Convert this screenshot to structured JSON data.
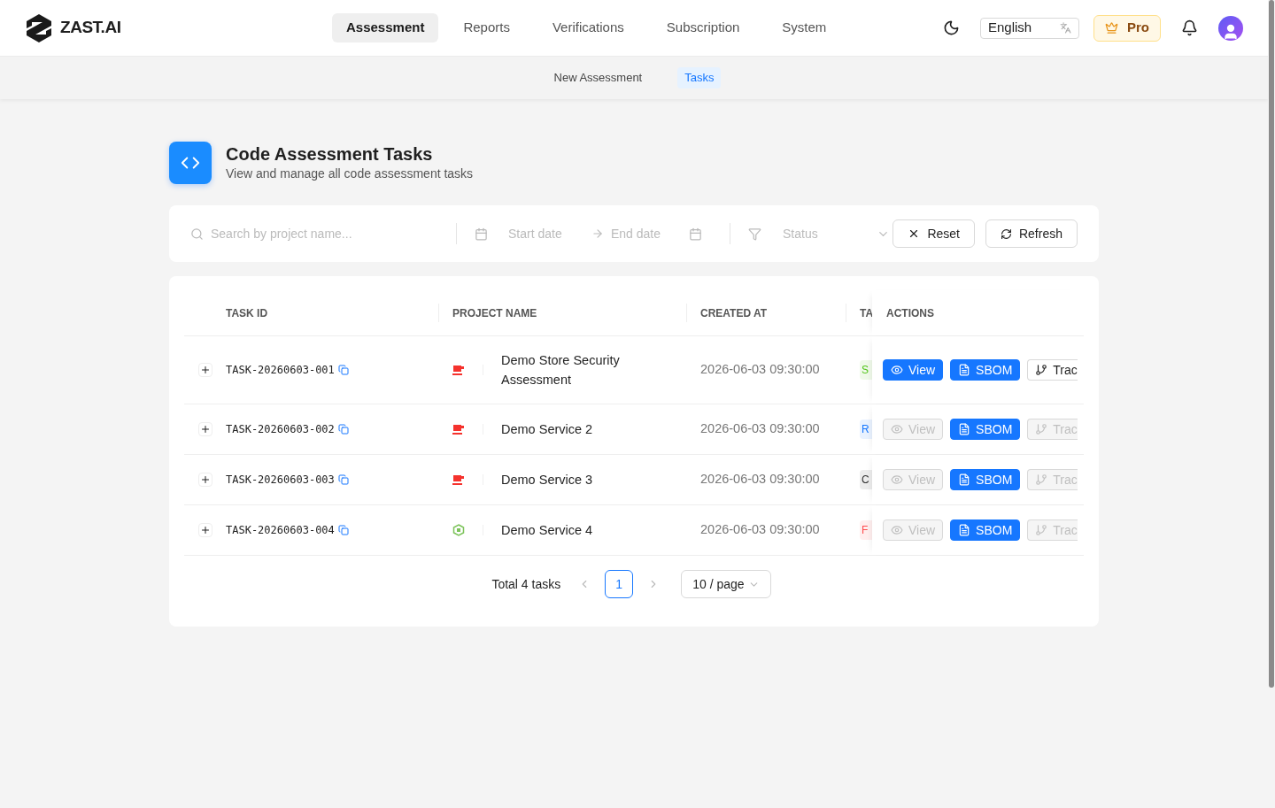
{
  "brand": {
    "name": "ZAST.AI"
  },
  "nav": [
    {
      "label": "Assessment",
      "selected": true
    },
    {
      "label": "Reports",
      "selected": false
    },
    {
      "label": "Verifications",
      "selected": false
    },
    {
      "label": "Subscription",
      "selected": false
    },
    {
      "label": "System",
      "selected": false
    }
  ],
  "language": {
    "value": "English"
  },
  "plan_badge": {
    "label": "Pro"
  },
  "subnav": [
    {
      "label": "New Assessment",
      "selected": false
    },
    {
      "label": "Tasks",
      "selected": true
    }
  ],
  "page": {
    "title": "Code Assessment Tasks",
    "subtitle": "View and manage all code assessment tasks"
  },
  "filters": {
    "search": {
      "placeholder": "Search by project name..."
    },
    "start_date": {
      "placeholder": "Start date"
    },
    "end_date": {
      "placeholder": "End date"
    },
    "status": {
      "placeholder": "Status"
    },
    "buttons": [
      {
        "kind": "reset",
        "label": "Reset"
      },
      {
        "kind": "refresh",
        "label": "Refresh"
      }
    ]
  },
  "table": {
    "columns": [
      "TASK ID",
      "PROJECT NAME",
      "CREATED AT",
      "TA",
      "ACTIONS"
    ],
    "rows": [
      {
        "task_id": "TASK-20260603-001",
        "project_icon": {
          "kind": "cup"
        },
        "project": "Demo Store Security Assessment",
        "created_at": "2026-06-03 09:30:00",
        "status": {
          "label": "S",
          "color": "#52c41a"
        },
        "actions": [
          {
            "kind": "view",
            "label": "View",
            "disabled": false
          },
          {
            "kind": "sbom",
            "label": "SBOM",
            "disabled": false
          },
          {
            "kind": "trace",
            "label": "Trac",
            "disabled": false
          }
        ]
      },
      {
        "task_id": "TASK-20260603-002",
        "project_icon": {
          "kind": "cup"
        },
        "project": "Demo Service 2",
        "created_at": "2026-06-03 09:30:00",
        "status": {
          "label": "R",
          "color": "#1677ff"
        },
        "actions": [
          {
            "kind": "view",
            "label": "View",
            "disabled": true
          },
          {
            "kind": "sbom",
            "label": "SBOM",
            "disabled": false
          },
          {
            "kind": "trace",
            "label": "Trac",
            "disabled": true
          }
        ]
      },
      {
        "task_id": "TASK-20260603-003",
        "project_icon": {
          "kind": "cup"
        },
        "project": "Demo Service 3",
        "created_at": "2026-06-03 09:30:00",
        "status": {
          "label": "C",
          "color": "#333333"
        },
        "actions": [
          {
            "kind": "view",
            "label": "View",
            "disabled": true
          },
          {
            "kind": "sbom",
            "label": "SBOM",
            "disabled": false
          },
          {
            "kind": "trace",
            "label": "Trac",
            "disabled": true
          }
        ]
      },
      {
        "task_id": "TASK-20260603-004",
        "project_icon": {
          "kind": "hexagon"
        },
        "project": "Demo Service 4",
        "created_at": "2026-06-03 09:30:00",
        "status": {
          "label": "F",
          "color": "#ff4d4f"
        },
        "actions": [
          {
            "kind": "view",
            "label": "View",
            "disabled": true
          },
          {
            "kind": "sbom",
            "label": "SBOM",
            "disabled": false
          },
          {
            "kind": "trace",
            "label": "Trac",
            "disabled": true
          }
        ]
      }
    ]
  },
  "pagination": {
    "total": "Total 4 tasks",
    "pages": [
      {
        "label": "1",
        "selected": true
      }
    ],
    "page_size": "10 / page"
  }
}
